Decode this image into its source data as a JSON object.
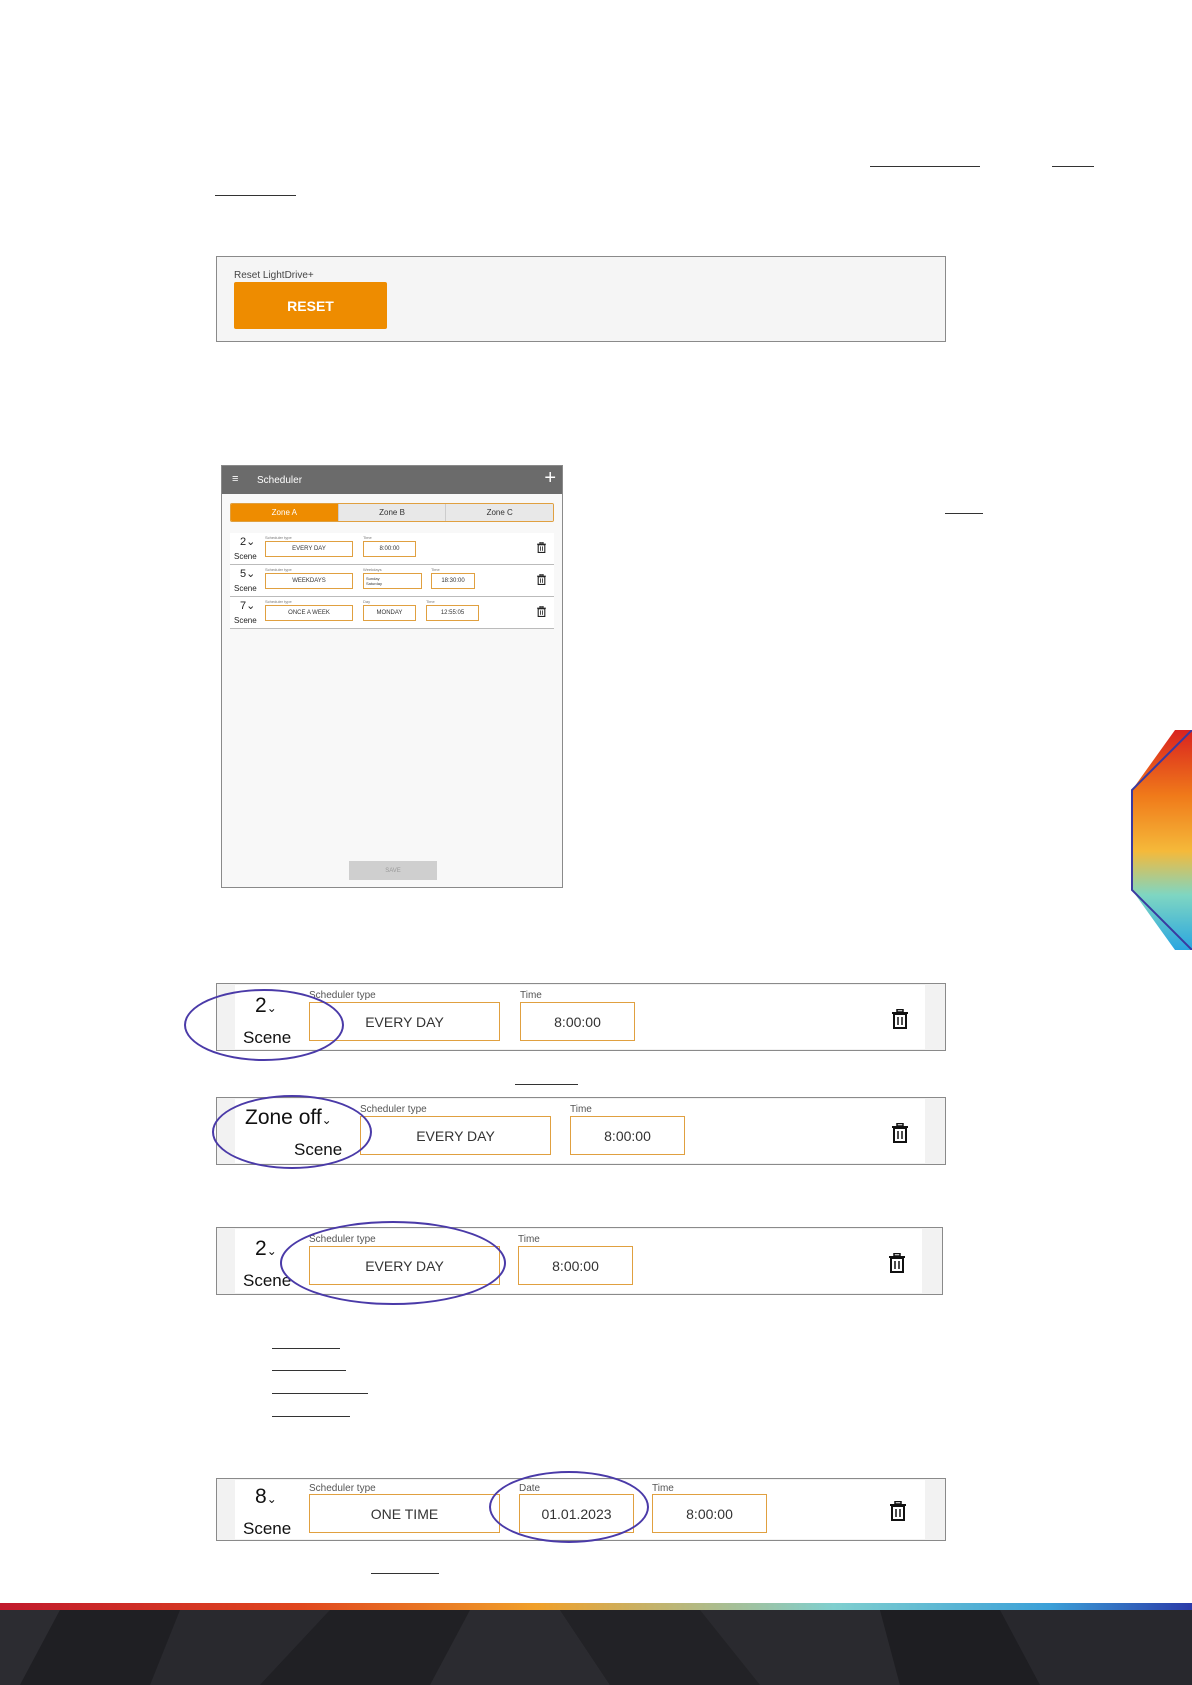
{
  "reset_section": {
    "label": "Reset LightDrive+",
    "button": "RESET"
  },
  "phone": {
    "title": "Scheduler",
    "menu_icon": "≡",
    "add_icon": "+",
    "tabs": [
      "Zone A",
      "Zone B",
      "Zone C"
    ],
    "rows": [
      {
        "number": "2",
        "scene": "Scene",
        "type_label": "Scheduler type",
        "type": "EVERY DAY",
        "f2_label": "Time",
        "f2": "8:00:00"
      },
      {
        "number": "5",
        "scene": "Scene",
        "type_label": "Scheduler type",
        "type": "WEEKDAYS",
        "f2_label": "Weekdays",
        "f2_line1": "Sunday",
        "f2_line2": "Saturday",
        "f3_label": "Time",
        "f3": "18:30:00"
      },
      {
        "number": "7",
        "scene": "Scene",
        "type_label": "Scheduler type",
        "type": "ONCE A WEEK",
        "f2_label": "Day",
        "f2": "MONDAY",
        "f3_label": "Time",
        "f3": "12:55:05"
      }
    ],
    "save": "SAVE"
  },
  "rows": [
    {
      "number": "2",
      "scene": "Scene",
      "type_label": "Scheduler type",
      "type": "EVERY DAY",
      "time_label": "Time",
      "time": "8:00:00"
    },
    {
      "number": "Zone off",
      "scene": "Scene",
      "type_label": "Scheduler type",
      "type": "EVERY DAY",
      "time_label": "Time",
      "time": "8:00:00"
    },
    {
      "number": "2",
      "scene": "Scene",
      "type_label": "Scheduler type",
      "type": "EVERY DAY",
      "time_label": "Time",
      "time": "8:00:00"
    },
    {
      "number": "8",
      "scene": "Scene",
      "type_label": "Scheduler type",
      "type": "ONE TIME",
      "date_label": "Date",
      "date": "01.01.2023",
      "time_label": "Time",
      "time": "8:00:00"
    }
  ],
  "colors": {
    "accent": "#ee8c00",
    "field_border": "#e0a040",
    "highlight_ellipse": "#4a3aa8",
    "footer": "#232327"
  }
}
